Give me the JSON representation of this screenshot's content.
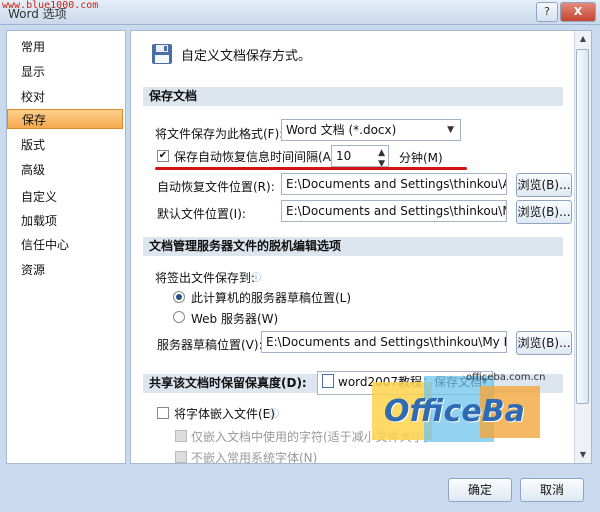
{
  "window": {
    "title": "Word 选项",
    "watermark_url": "www.blue1000.com",
    "help_label": "?",
    "close_label": "X"
  },
  "sidebar": {
    "items": [
      {
        "label": "常用"
      },
      {
        "label": "显示"
      },
      {
        "label": "校对"
      },
      {
        "label": "保存",
        "selected": true
      },
      {
        "label": "版式"
      },
      {
        "label": "高级"
      },
      {
        "label": "自定义"
      },
      {
        "label": "加载项"
      },
      {
        "label": "信任中心"
      },
      {
        "label": "资源"
      }
    ]
  },
  "header": {
    "text": "自定义文档保存方式。",
    "icon": "save-disk-icon"
  },
  "save_section": {
    "title": "保存文档",
    "format_label": "将文件保存为此格式(F):",
    "format_value": "Word 文档 (*.docx)",
    "autorecover_label": "保存自动恢复信息时间间隔(A)",
    "autorecover_checked": true,
    "autorecover_value": "10",
    "minutes_label": "分钟(M)",
    "autorecover_location_label": "自动恢复文件位置(R):",
    "autorecover_location_value": "E:\\Documents and Settings\\thinkou\\Application Data",
    "default_location_label": "默认文件位置(I):",
    "default_location_value": "E:\\Documents and Settings\\thinkou\\My Documents\\",
    "browse_label": "浏览(B)..."
  },
  "offline_section": {
    "title": "文档管理服务器文件的脱机编辑选项",
    "checkout_label": "将签出文件保存到:",
    "option_local": "此计算机的服务器草稿位置(L)",
    "option_web": "Web 服务器(W)",
    "drafts_label": "服务器草稿位置(V):",
    "drafts_value": "E:\\Documents and Settings\\thinkou\\My Documents\\SharePoint",
    "browse_label": "浏览(B)..."
  },
  "share_section": {
    "title": "共享该文档时保留保真度(D):",
    "doc_value": "word2007教程：保存文档",
    "embed_fonts_label": "将字体嵌入文件(E)",
    "embed_used_label": "仅嵌入文档中使用的字符(适于减小文件大小)",
    "no_common_label": "不嵌入常用系统字体(N)"
  },
  "overlay": {
    "logo_text": "OfficeBa",
    "logo_url": "officeba.com.cn"
  },
  "footer": {
    "ok_label": "确定",
    "cancel_label": "取消"
  },
  "colors": {
    "selected_nav": "#f6a94e",
    "section_bg": "#dde5ef",
    "highlight_line": "#d41414",
    "window_frame": "#c9d9ee"
  }
}
